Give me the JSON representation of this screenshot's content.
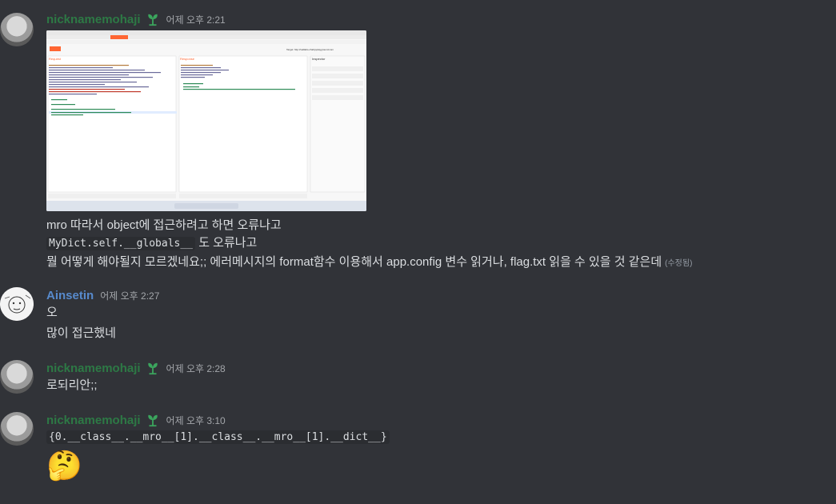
{
  "messages": [
    {
      "author": "nicknamemohaji",
      "time": "어제 오후 2:21",
      "attachment": {
        "app_title": "Burp Suite Community Edition",
        "request_label": "Request",
        "response_label": "Response",
        "inspector_label": "Inspector",
        "target_label": "Target: http://vaillabs-chall.jsplayground.com"
      },
      "lines": [
        "mro 따라서 object에 접근하려고 하면 오류나고",
        "MyDict.self.__globals__",
        "도 오류나고",
        "뭘 어떻게 해야될지 모르겠네요;; 에러메시지의 format함수 이용해서 app.config 변수 읽거나, flag.txt 읽을 수 있을 것 같은데",
        "(수정됨)"
      ]
    },
    {
      "author": "Ainsetin",
      "time": "어제 오후 2:27",
      "lines": [
        "오",
        "많이 접근했네"
      ]
    },
    {
      "author": "nicknamemohaji",
      "time": "어제 오후 2:28",
      "lines": [
        "로되리안;;"
      ]
    },
    {
      "author": "nicknamemohaji",
      "time": "어제 오후 3:10",
      "lines": [
        "{0.__class__.__mro__[1].__class__.__mro__[1].__dict__}"
      ],
      "emoji": "🤔"
    }
  ],
  "colors": {
    "background": "#313338",
    "username_green": "#2d7d46",
    "username_blue": "#5a8fd4",
    "timestamp": "#a3a6aa"
  },
  "icons": [
    "sprout-badge-icon"
  ]
}
